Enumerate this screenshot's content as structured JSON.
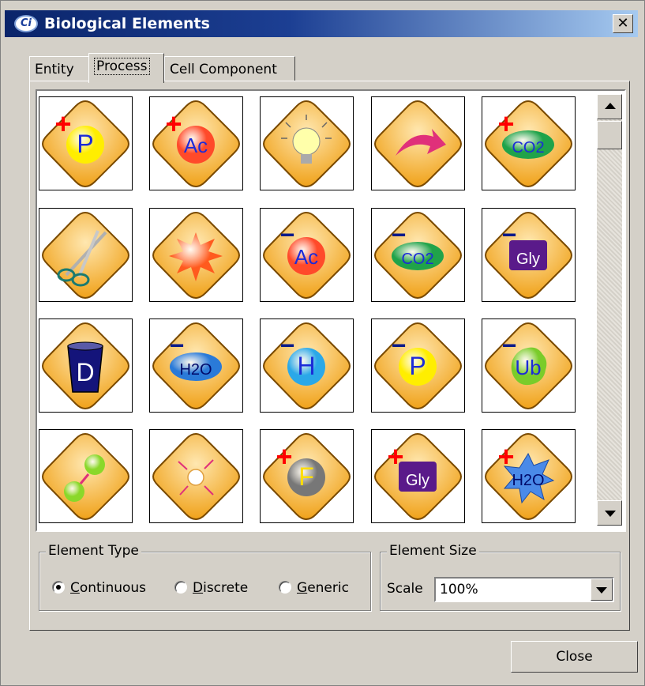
{
  "window": {
    "title": "Biological Elements",
    "close_glyph": "✕",
    "app_icon_text": "Ci"
  },
  "tabs": [
    {
      "label": "Entity",
      "active": false
    },
    {
      "label": "Process",
      "active": true
    },
    {
      "label": "Cell Component",
      "active": false
    }
  ],
  "palette": {
    "items": [
      {
        "name": "phosphorylation",
        "icon": "plus-p-icon",
        "sign": "+",
        "badge": "P",
        "shape": "circle",
        "color": "#ffee00",
        "text_color": "#1c2bd8"
      },
      {
        "name": "acetylation",
        "icon": "plus-ac-icon",
        "sign": "+",
        "badge": "Ac",
        "shape": "circle",
        "color": "#ff4a2a",
        "text_color": "#1c2bd8"
      },
      {
        "name": "activation",
        "icon": "lightbulb-icon",
        "badge": "",
        "shape": "bulb",
        "color": "#ffffaa",
        "text_color": "#000000"
      },
      {
        "name": "translocation",
        "icon": "curved-arrow-icon",
        "badge": "",
        "shape": "arrow",
        "color": "#e0307a",
        "text_color": "#000000"
      },
      {
        "name": "carboxylation",
        "icon": "plus-co2-icon",
        "sign": "+",
        "badge": "CO2",
        "shape": "ellipse",
        "color": "#20a34a",
        "text_color": "#1c2bd8"
      },
      {
        "name": "cleavage",
        "icon": "scissors-icon",
        "badge": "",
        "shape": "scissors",
        "color": "#1a7a70",
        "text_color": "#000000"
      },
      {
        "name": "burst",
        "icon": "starburst-icon",
        "badge": "",
        "shape": "burst",
        "color": "#ff5a1e",
        "text_color": "#000000"
      },
      {
        "name": "deacetylation",
        "icon": "minus-ac-icon",
        "sign": "−",
        "badge": "Ac",
        "shape": "circle",
        "color": "#ff4a2a",
        "text_color": "#1c2bd8"
      },
      {
        "name": "decarboxylation",
        "icon": "minus-co2-icon",
        "sign": "−",
        "badge": "CO2",
        "shape": "ellipse",
        "color": "#20a34a",
        "text_color": "#1c2bd8"
      },
      {
        "name": "deglycosylation",
        "icon": "minus-gly-icon",
        "sign": "−",
        "badge": "Gly",
        "shape": "rect",
        "color": "#5a1a8a",
        "text_color": "#ffffff"
      },
      {
        "name": "degradation",
        "icon": "trash-bin-icon",
        "badge": "D",
        "shape": "bin",
        "color": "#14147a",
        "text_color": "#ffffff"
      },
      {
        "name": "dehydration",
        "icon": "minus-h2o-icon",
        "sign": "−",
        "badge": "H2O",
        "shape": "ellipse",
        "color": "#2a7ad8",
        "text_color": "#000a6a"
      },
      {
        "name": "dehydrogenation",
        "icon": "minus-h-icon",
        "sign": "−",
        "badge": "H",
        "shape": "circle",
        "color": "#2aa8e8",
        "text_color": "#1c2bd8"
      },
      {
        "name": "dephosphorylation",
        "icon": "minus-p-icon",
        "sign": "−",
        "badge": "P",
        "shape": "circle",
        "color": "#ffee00",
        "text_color": "#1c2bd8"
      },
      {
        "name": "deubiquitination",
        "icon": "minus-ub-icon",
        "sign": "−",
        "badge": "Ub",
        "shape": "blob",
        "color": "#7acc2a",
        "text_color": "#1c2bd8"
      },
      {
        "name": "dissociation",
        "icon": "split-spheres-icon",
        "badge": "",
        "shape": "spheres",
        "color": "#8ad82a",
        "text_color": "#000000"
      },
      {
        "name": "explosion",
        "icon": "scatter-arrows-icon",
        "badge": "",
        "shape": "scatter",
        "color": "#e0307a",
        "text_color": "#000000"
      },
      {
        "name": "fluorination",
        "icon": "plus-f-icon",
        "sign": "+",
        "badge": "F",
        "shape": "circle",
        "color": "#777777",
        "text_color": "#ffdd00"
      },
      {
        "name": "glycosylation",
        "icon": "plus-gly-icon",
        "sign": "+",
        "badge": "Gly",
        "shape": "rect",
        "color": "#5a1a8a",
        "text_color": "#ffffff"
      },
      {
        "name": "hydration",
        "icon": "plus-h2o-icon",
        "sign": "+",
        "badge": "H2O",
        "shape": "star",
        "color": "#4a8ae8",
        "text_color": "#000a6a"
      }
    ]
  },
  "scrollbar": {
    "up_icon": "scroll-up-arrow",
    "down_icon": "scroll-down-arrow"
  },
  "element_type": {
    "legend": "Element Type",
    "options": [
      {
        "label": "Continuous",
        "underline": "C",
        "rest": "ontinuous",
        "selected": true
      },
      {
        "label": "Discrete",
        "underline": "D",
        "rest": "iscrete",
        "selected": false
      },
      {
        "label": "Generic",
        "underline": "G",
        "rest": "eneric",
        "selected": false
      }
    ]
  },
  "element_size": {
    "legend": "Element Size",
    "scale_label": "Scale",
    "scale_value": "100%"
  },
  "footer": {
    "close_label": "Close"
  },
  "colors": {
    "diamond_light": "#ffe7b0",
    "diamond_dark": "#f0a21a",
    "diamond_edge": "#7a4a00",
    "sign_red": "#ff0000",
    "sign_blue": "#0a1a8a"
  }
}
